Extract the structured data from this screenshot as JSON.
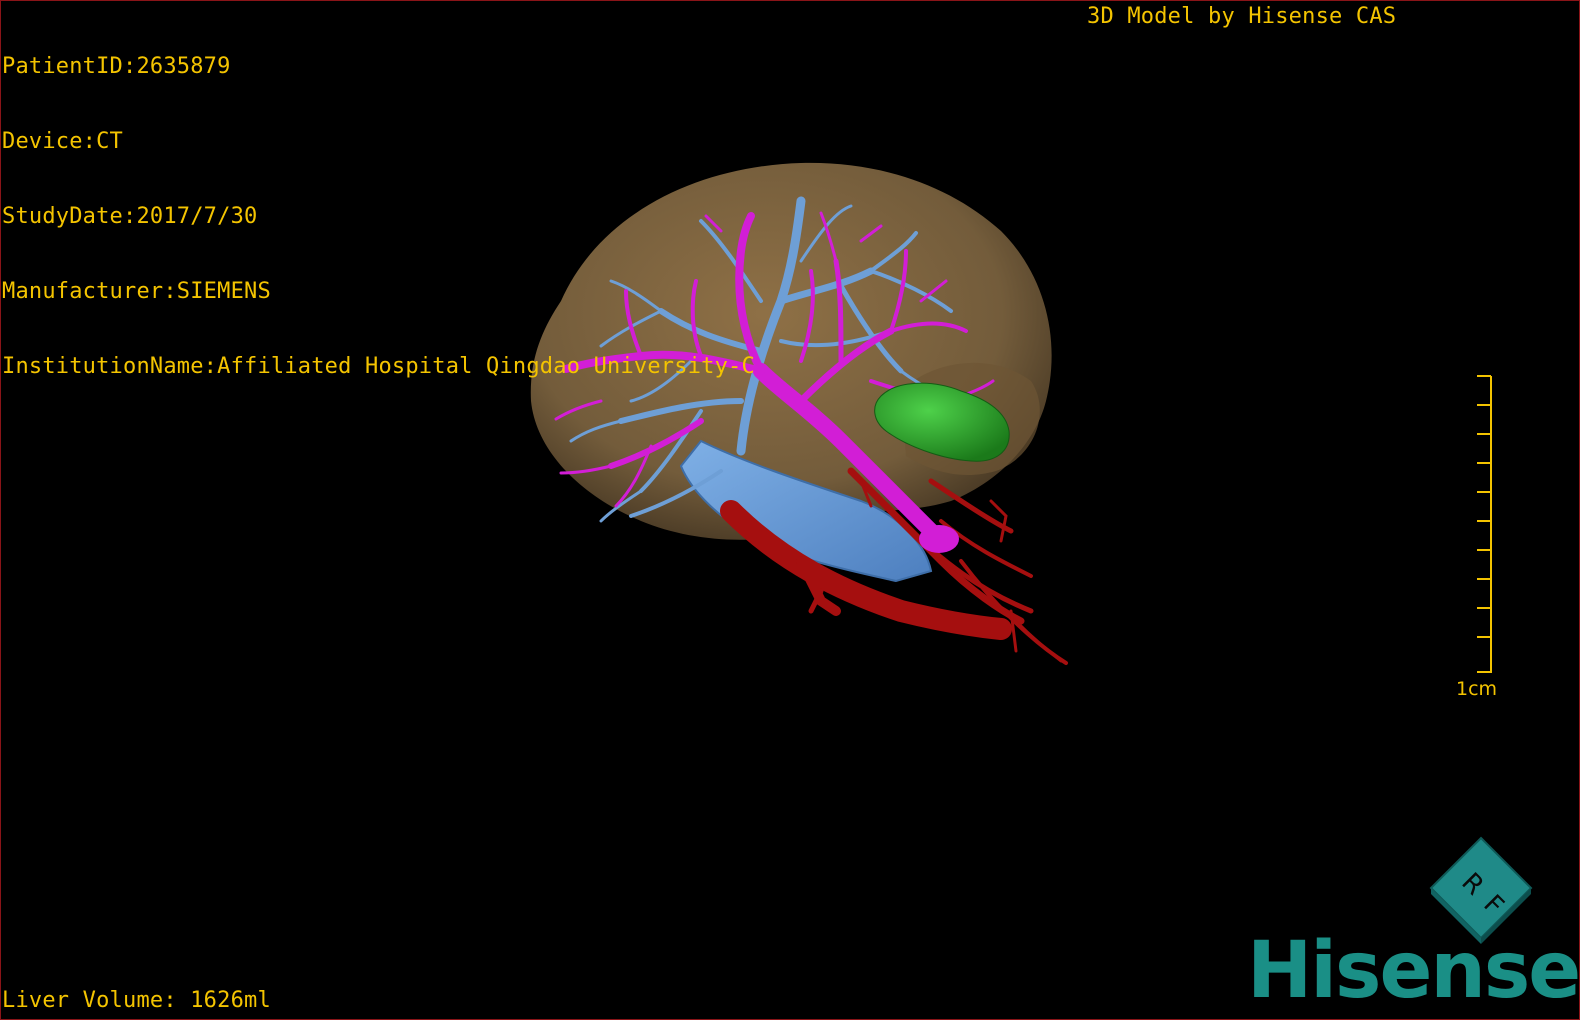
{
  "header_info": {
    "patient_id": "PatientID:2635879",
    "device": "Device:CT",
    "study_date": "StudyDate:2017/7/30",
    "manufacturer": "Manufacturer:SIEMENS",
    "institution": "InstitutionName:Affiliated Hospital Qingdao University-C"
  },
  "brand_caption": "3D Model by Hisense CAS",
  "liver_volume": "Liver Volume: 1626ml",
  "scale": {
    "label": "1cm"
  },
  "orientation_cube": {
    "label_top": "R",
    "label_side": "F"
  },
  "logo": {
    "text": "Hisense"
  },
  "colors": {
    "overlay_text": "#f4c400",
    "liver": "#8a6d45",
    "hepatic_vein": "#6e9fd6",
    "portal_vein": "#d21ed6",
    "artery": "#b01010",
    "tumor": "#2aa82a",
    "logo": "#1a8f86"
  },
  "model_parts": [
    "liver-surface",
    "hepatic-veins",
    "portal-veins",
    "hepatic-arteries",
    "lesion"
  ]
}
